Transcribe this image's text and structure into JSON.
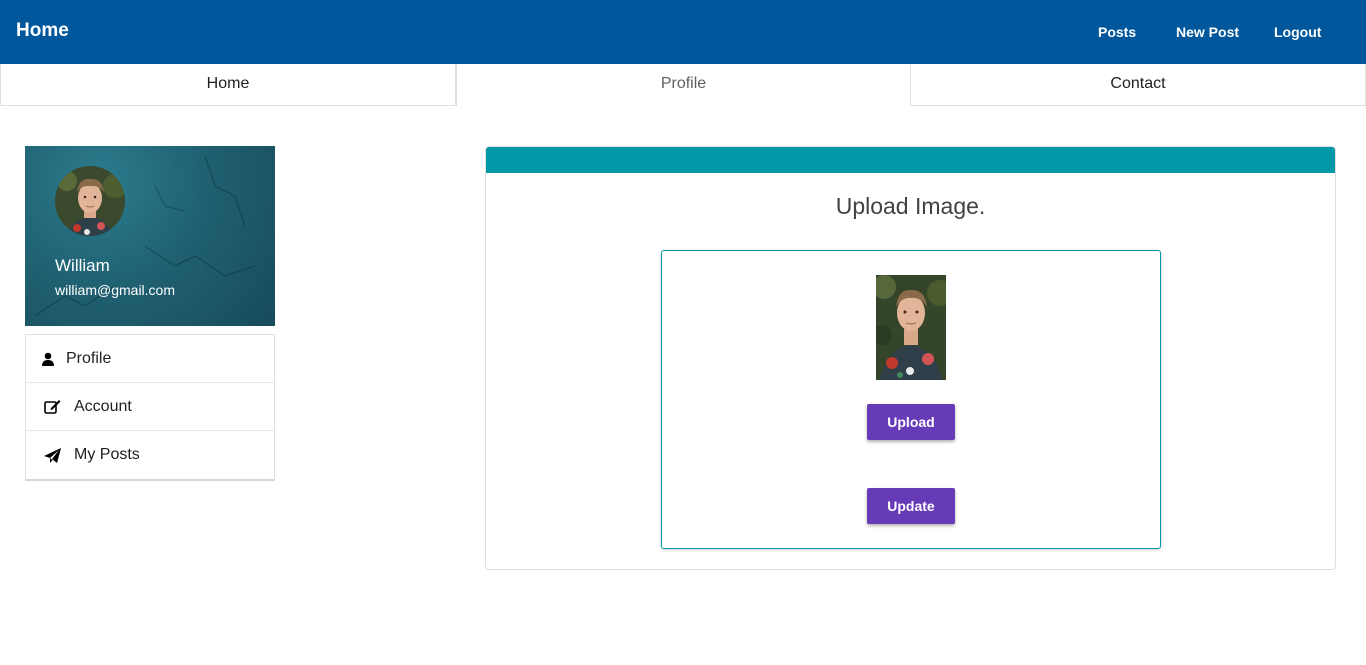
{
  "navbar": {
    "brand": "Home",
    "links": [
      "Posts",
      "New Post",
      "Logout"
    ]
  },
  "tabs": [
    "Home",
    "Profile",
    "Contact"
  ],
  "active_tab": "Profile",
  "profile": {
    "name": "William",
    "email": "william@gmail.com"
  },
  "side_menu": [
    {
      "label": "Profile",
      "icon": "user-icon"
    },
    {
      "label": "Account",
      "icon": "edit-icon"
    },
    {
      "label": "My Posts",
      "icon": "paper-plane-icon"
    }
  ],
  "upload": {
    "title": "Upload Image.",
    "upload_label": "Upload",
    "update_label": "Update"
  },
  "colors": {
    "navbar": "#01579b",
    "card_header": "#0097a7",
    "button": "#673ab7"
  }
}
